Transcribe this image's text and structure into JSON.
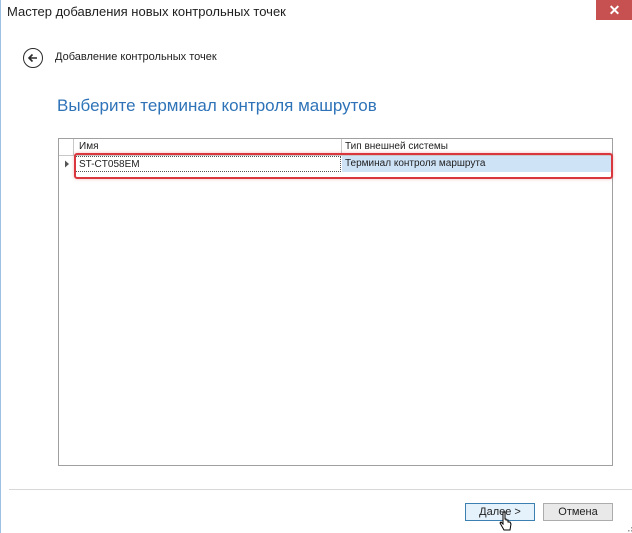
{
  "window": {
    "title": "Мастер добавления новых контрольных точек",
    "close_symbol": "✕"
  },
  "nav": {
    "back_icon": "arrow-left-circle-icon",
    "title": "Добавление контрольных точек"
  },
  "heading": "Выберите терминал контроля машрутов",
  "grid": {
    "columns": [
      "Имя",
      "Тип внешней системы"
    ],
    "rows": [
      {
        "name": "ST-CT058EM",
        "type": "Терминал контроля маршрута",
        "selected": true
      }
    ]
  },
  "buttons": {
    "next": "Далее >",
    "cancel": "Отмена"
  },
  "colors": {
    "accent": "#2e73b8",
    "close": "#c75050",
    "highlight": "#d9363e",
    "selection": "#cfe3f7"
  }
}
